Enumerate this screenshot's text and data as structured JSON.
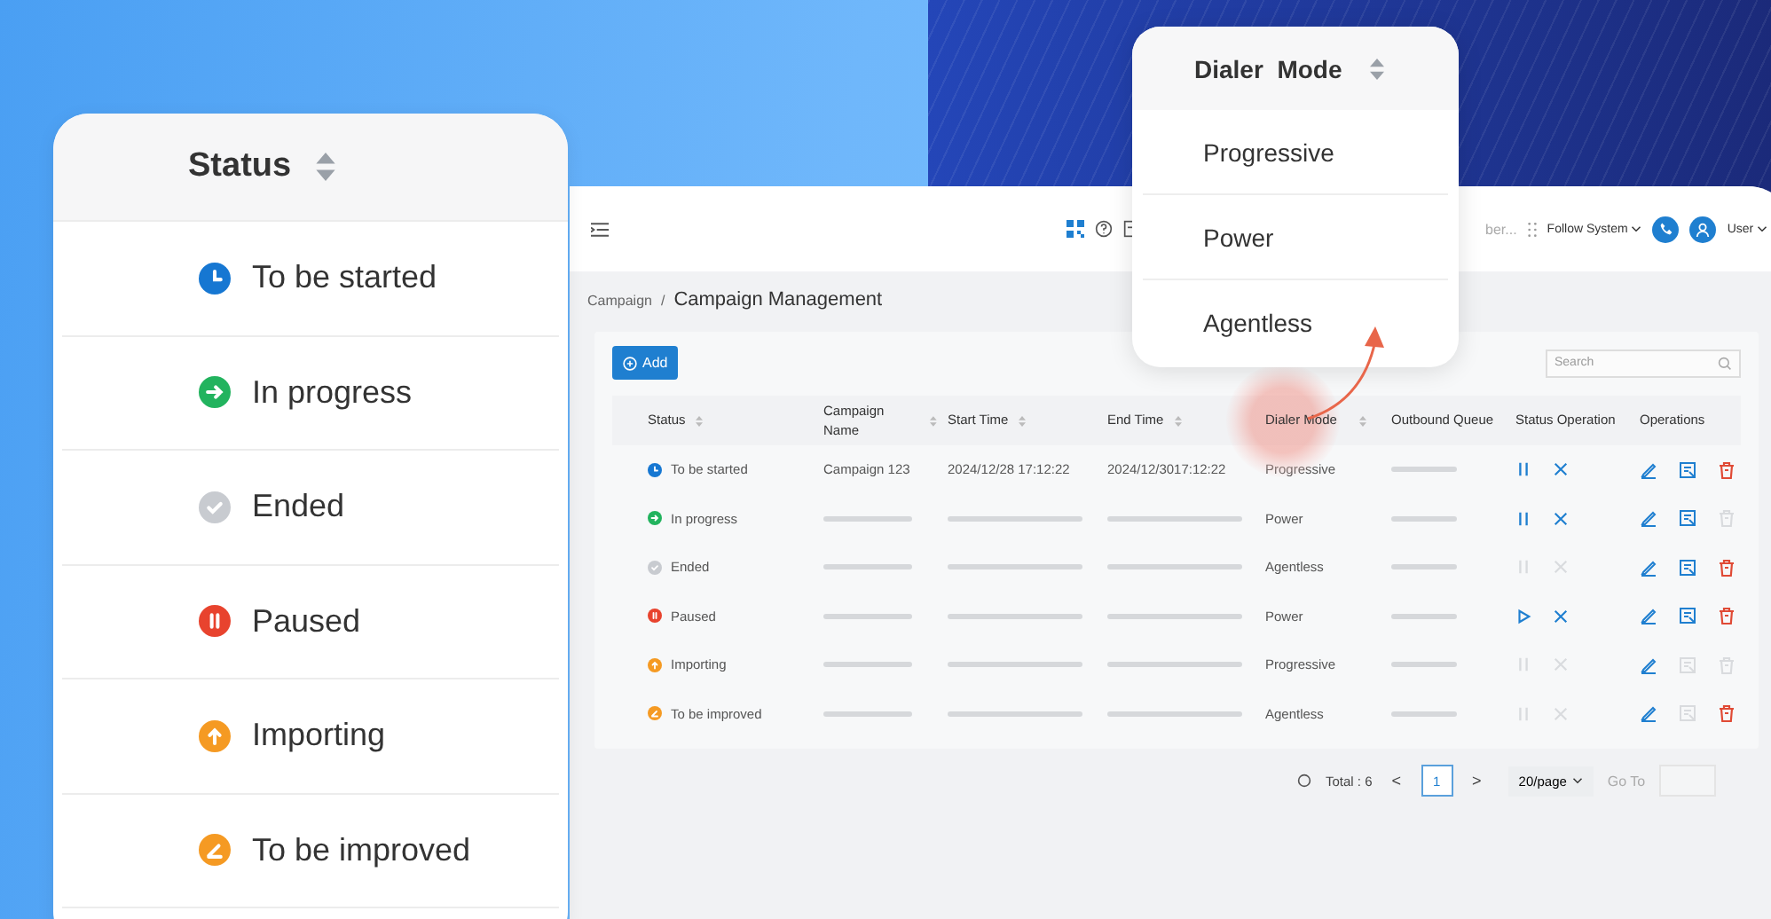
{
  "status_card": {
    "title": "Status",
    "items": [
      {
        "label": "To be started",
        "kind": "clock",
        "color": "#1677d2"
      },
      {
        "label": "In progress",
        "kind": "arrow",
        "color": "#22b35e"
      },
      {
        "label": "Ended",
        "kind": "check",
        "color": "#c8cbd0"
      },
      {
        "label": "Paused",
        "kind": "pause",
        "color": "#e8432e"
      },
      {
        "label": "Importing",
        "kind": "up",
        "color": "#f59a23"
      },
      {
        "label": "To be improved",
        "kind": "edit",
        "color": "#f59a23"
      }
    ]
  },
  "dialer_popup": {
    "title": "Dialer  Mode",
    "options": [
      "Progressive",
      "Power",
      "Agentless"
    ]
  },
  "header": {
    "search_text": "ber...",
    "theme": "Follow System",
    "user": "User"
  },
  "breadcrumb": {
    "parent": "Campaign",
    "separator": "/",
    "current": "Campaign Management"
  },
  "toolbar": {
    "add": "Add",
    "search_placeholder": "Search"
  },
  "table": {
    "columns": [
      "Status",
      "Campaign Name",
      "Start Time",
      "End Time",
      "Dialer Mode",
      "Outbound Queue",
      "Status Operation",
      "Operations"
    ],
    "rows": [
      {
        "status": {
          "label": "To be started",
          "kind": "clock",
          "color": "#1677d2"
        },
        "name": "Campaign 123",
        "start": "2024/12/28 17:12:22",
        "end": "2024/12/3017:12:22",
        "mode": "Progressive",
        "toggle": {
          "kind": "pause",
          "enabled": true
        },
        "cancel_enabled": true,
        "review_enabled": true,
        "delete_enabled": true
      },
      {
        "status": {
          "label": "In progress",
          "kind": "arrow",
          "color": "#22b35e"
        },
        "name": null,
        "start": null,
        "end": null,
        "mode": "Power",
        "toggle": {
          "kind": "pause",
          "enabled": true
        },
        "cancel_enabled": true,
        "review_enabled": true,
        "delete_enabled": false
      },
      {
        "status": {
          "label": "Ended",
          "kind": "check",
          "color": "#c8cbd0"
        },
        "name": null,
        "start": null,
        "end": null,
        "mode": "Agentless",
        "toggle": {
          "kind": "pause",
          "enabled": false
        },
        "cancel_enabled": false,
        "review_enabled": true,
        "delete_enabled": true
      },
      {
        "status": {
          "label": "Paused",
          "kind": "pause",
          "color": "#e8432e"
        },
        "name": null,
        "start": null,
        "end": null,
        "mode": "Power",
        "toggle": {
          "kind": "play",
          "enabled": true
        },
        "cancel_enabled": true,
        "review_enabled": true,
        "delete_enabled": true
      },
      {
        "status": {
          "label": "Importing",
          "kind": "up",
          "color": "#f59a23"
        },
        "name": null,
        "start": null,
        "end": null,
        "mode": "Progressive",
        "toggle": {
          "kind": "pause",
          "enabled": false
        },
        "cancel_enabled": false,
        "review_enabled": false,
        "delete_enabled": false
      },
      {
        "status": {
          "label": "To be improved",
          "kind": "edit",
          "color": "#f59a23"
        },
        "name": null,
        "start": null,
        "end": null,
        "mode": "Agentless",
        "toggle": {
          "kind": "pause",
          "enabled": false
        },
        "cancel_enabled": false,
        "review_enabled": false,
        "delete_enabled": true
      }
    ]
  },
  "pagination": {
    "total": "Total : 6",
    "prev": "<",
    "pages": [
      {
        "label": "1",
        "selected": true
      }
    ],
    "next": ">",
    "page_size": "20/page",
    "goto": "Go To"
  }
}
